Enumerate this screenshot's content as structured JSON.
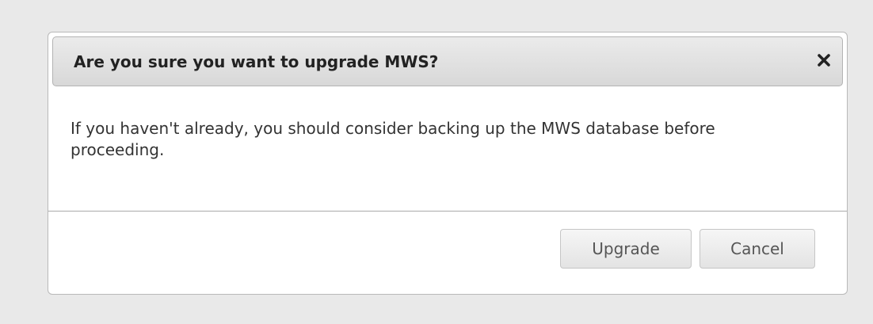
{
  "dialog": {
    "title": "Are you sure you want to upgrade MWS?",
    "close_icon": "close-icon",
    "message": "If you haven't already, you should consider backing up the MWS database before proceeding.",
    "buttons": {
      "upgrade_label": "Upgrade",
      "cancel_label": "Cancel"
    }
  }
}
